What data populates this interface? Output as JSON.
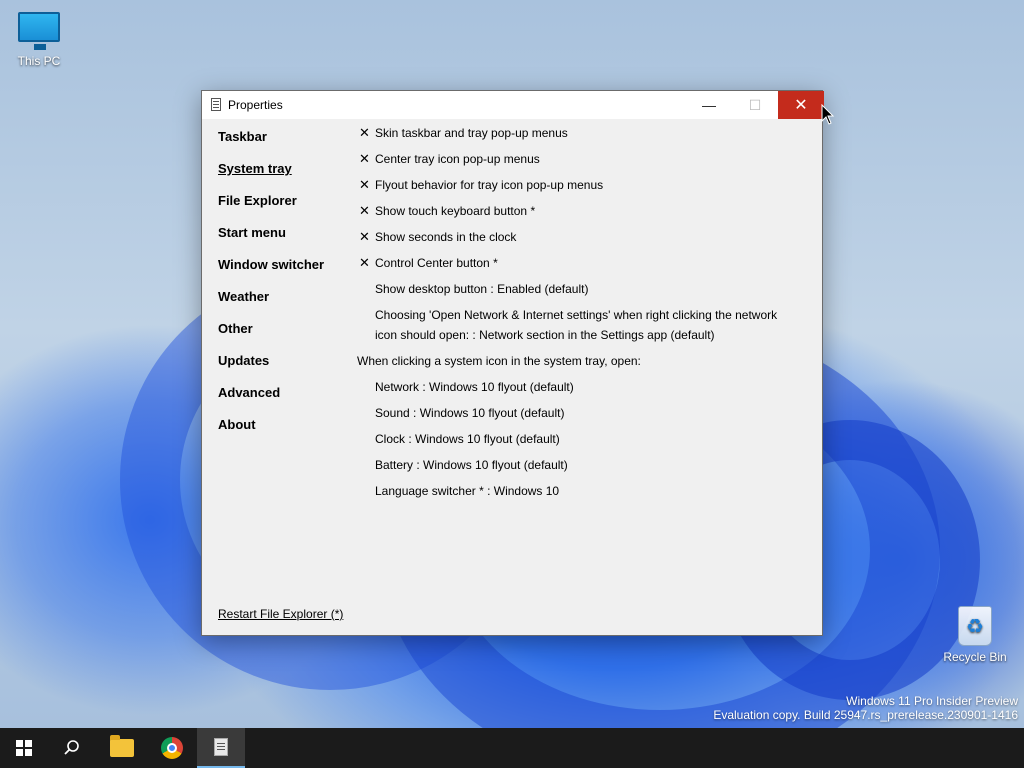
{
  "desktop": {
    "icons": [
      {
        "label": "This PC"
      },
      {
        "label": "Recycle Bin"
      }
    ],
    "watermark": {
      "line1": "Windows 11 Pro Insider Preview",
      "line2": "Evaluation copy. Build 25947.rs_prerelease.230901-1416"
    }
  },
  "window": {
    "title": "Properties",
    "controls": {
      "minimize": "—",
      "maximize": "☐",
      "close": "✕"
    },
    "nav": [
      {
        "label": "Taskbar"
      },
      {
        "label": "System tray",
        "selected": true
      },
      {
        "label": "File Explorer"
      },
      {
        "label": "Start menu"
      },
      {
        "label": "Window switcher"
      },
      {
        "label": "Weather"
      },
      {
        "label": "Other"
      },
      {
        "label": "Updates"
      },
      {
        "label": "Advanced"
      },
      {
        "label": "About"
      }
    ],
    "options": [
      {
        "mark": "✕",
        "label": "Skin taskbar and tray pop-up menus"
      },
      {
        "mark": "✕",
        "label": "Center tray icon pop-up menus"
      },
      {
        "mark": "✕",
        "label": "Flyout behavior for tray icon pop-up menus"
      },
      {
        "mark": "✕",
        "label": "Show touch keyboard button *"
      },
      {
        "mark": "✕",
        "label": "Show seconds in the clock"
      },
      {
        "mark": "✕",
        "label": "Control Center button *"
      },
      {
        "mark": "",
        "label": "Show desktop button : Enabled (default)"
      },
      {
        "mark": "",
        "label": "Choosing 'Open Network & Internet settings' when right clicking the network icon should open: : Network section in the Settings app (default)"
      }
    ],
    "section_header": "When clicking a system icon in the system tray, open:",
    "sub_options": [
      {
        "label": "Network : Windows 10 flyout (default)"
      },
      {
        "label": "Sound : Windows 10 flyout (default)"
      },
      {
        "label": "Clock : Windows 10 flyout (default)"
      },
      {
        "label": "Battery : Windows 10 flyout (default)"
      },
      {
        "label": "Language switcher * : Windows 10"
      }
    ],
    "restart_link": "Restart File Explorer (*)"
  },
  "taskbar": {
    "items": [
      {
        "name": "start-button",
        "icon": "windows-logo-icon"
      },
      {
        "name": "search-button",
        "icon": "search-icon",
        "glyph": "⌕"
      },
      {
        "name": "file-explorer-button",
        "icon": "folder-icon"
      },
      {
        "name": "chrome-button",
        "icon": "chrome-icon"
      },
      {
        "name": "properties-button",
        "icon": "properties-app-icon",
        "active": true
      }
    ]
  },
  "colors": {
    "close_button": "#c42b1c",
    "taskbar": "#1b1b1b",
    "window_bg": "#f0f0f0",
    "active_indicator": "#76b9ed"
  }
}
